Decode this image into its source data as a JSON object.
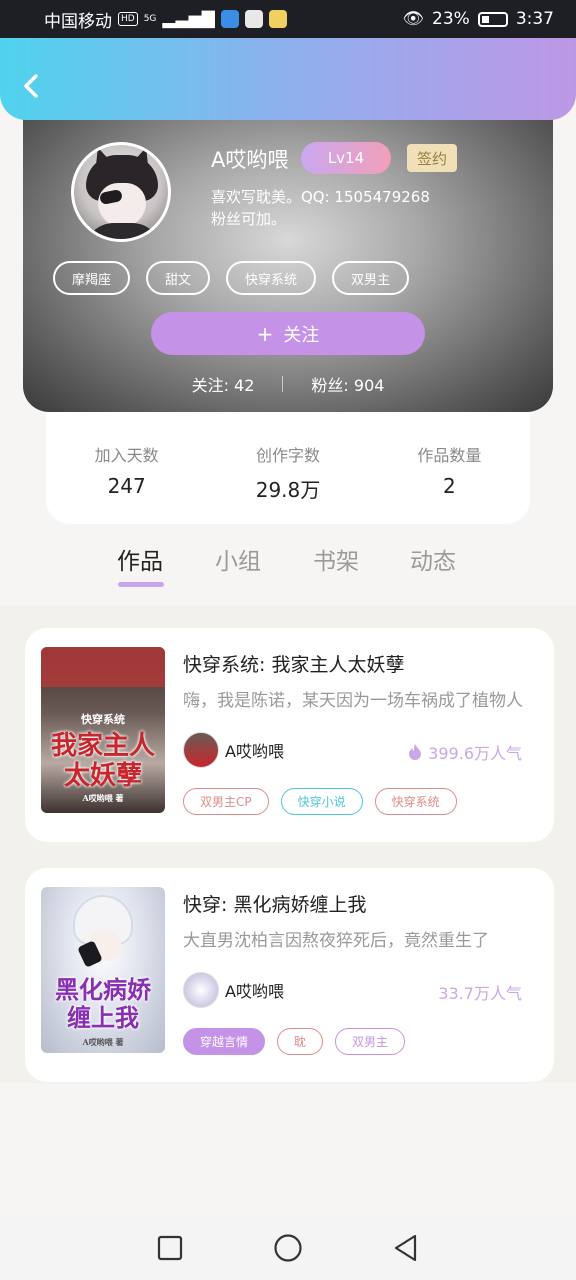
{
  "status_bar": {
    "carrier": "中国移动",
    "hd": "HD",
    "signal": "5G",
    "battery_percent": "23%",
    "time": "3:37"
  },
  "header": {
    "back_icon": "chevron-left-icon"
  },
  "profile": {
    "username": "A哎哟喂",
    "level": "Lv14",
    "signed": "签约",
    "bio_line1": "喜欢写耽美。QQ: 1505479268",
    "bio_line2": "粉丝可加。",
    "tags": [
      "摩羯座",
      "甜文",
      "快穿系统",
      "双男主"
    ],
    "follow_label": "关注",
    "following_label": "关注: 42",
    "fans_label": "粉丝: 904"
  },
  "stats": [
    {
      "label": "加入天数",
      "value": "247"
    },
    {
      "label": "创作字数",
      "value": "29.8万"
    },
    {
      "label": "作品数量",
      "value": "2"
    }
  ],
  "tabs": [
    "作品",
    "小组",
    "书架",
    "动态"
  ],
  "active_tab": "作品",
  "works": [
    {
      "title": "快穿系统: 我家主人太妖孽",
      "desc": "嗨，我是陈诺，某天因为一场车祸成了植物人",
      "author": "A哎哟喂",
      "popularity": "399.6万人气",
      "cover_text_top": "快穿系统",
      "cover_line1": "我家主人",
      "cover_line2": "太妖孽",
      "cover_author": "A哎哟喂 著",
      "tags": [
        {
          "label": "双男主CP",
          "color": "#e08b8b",
          "filled": false
        },
        {
          "label": "快穿小说",
          "color": "#4cc7d8",
          "filled": false
        },
        {
          "label": "快穿系统",
          "color": "#e08b8b",
          "filled": false
        }
      ]
    },
    {
      "title": "快穿: 黑化病娇缠上我",
      "desc": "大直男沈柏言因熬夜猝死后，竟然重生了",
      "author": "A哎哟喂",
      "popularity": "33.7万人气",
      "cover_line1": "黑化病娇",
      "cover_line2": "缠上我",
      "cover_author": "A哎哟喂 著",
      "tags": [
        {
          "label": "穿越言情",
          "color": "#c493e8",
          "filled": true
        },
        {
          "label": "耽",
          "color": "#e08b8b",
          "filled": false
        },
        {
          "label": "双男主",
          "color": "#c493e8",
          "filled": false
        }
      ]
    }
  ],
  "navbar": [
    "square-icon",
    "circle-icon",
    "triangle-back-icon"
  ],
  "colors": {
    "accent": "#c493e8",
    "header_start": "#4fd3ee",
    "header_end": "#bd97e6",
    "popularity": "#c9a8e8"
  }
}
